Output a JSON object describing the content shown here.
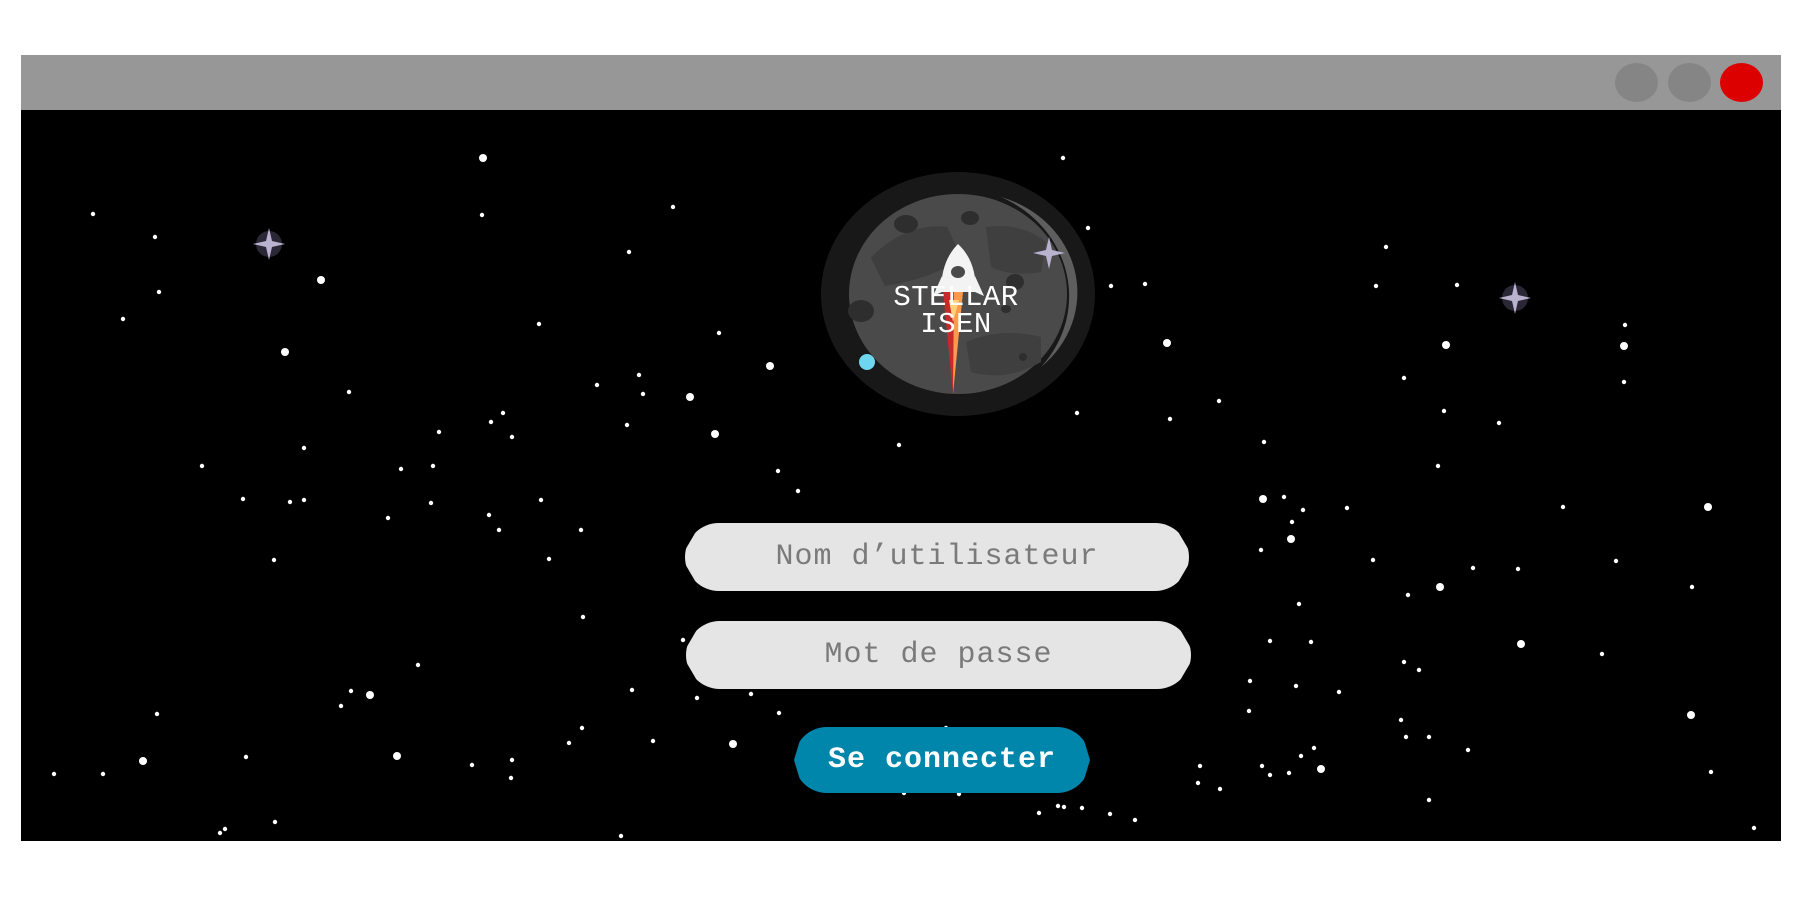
{
  "window": {
    "buttons": [
      "minimize",
      "maximize",
      "close"
    ],
    "colors": {
      "titlebar": "#979797",
      "button": "#858585",
      "close": "#dc0000",
      "background": "#000000"
    }
  },
  "logo": {
    "line1": "STELLAR",
    "line2": "ISEN",
    "icon": "rocket-moon-icon"
  },
  "form": {
    "username_placeholder": "Nom d’utilisateur",
    "password_placeholder": "Mot de passe",
    "submit_label": "Se connecter",
    "colors": {
      "field": "#e5e5e5",
      "button": "#0086ab"
    }
  }
}
